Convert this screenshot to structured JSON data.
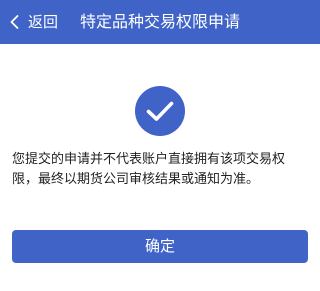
{
  "header": {
    "back_label": "返回",
    "title": "特定品种交易权限申请",
    "back_icon": "chevron-left-icon"
  },
  "main": {
    "status_icon": "check-circle-icon",
    "message": "您提交的申请并不代表账户直接拥有该项交易权限，最终以期货公司审核结果或通知为准。"
  },
  "footer": {
    "confirm_label": "确定"
  },
  "colors": {
    "primary": "#3f63c6",
    "text": "#222222",
    "background": "#ffffff"
  }
}
